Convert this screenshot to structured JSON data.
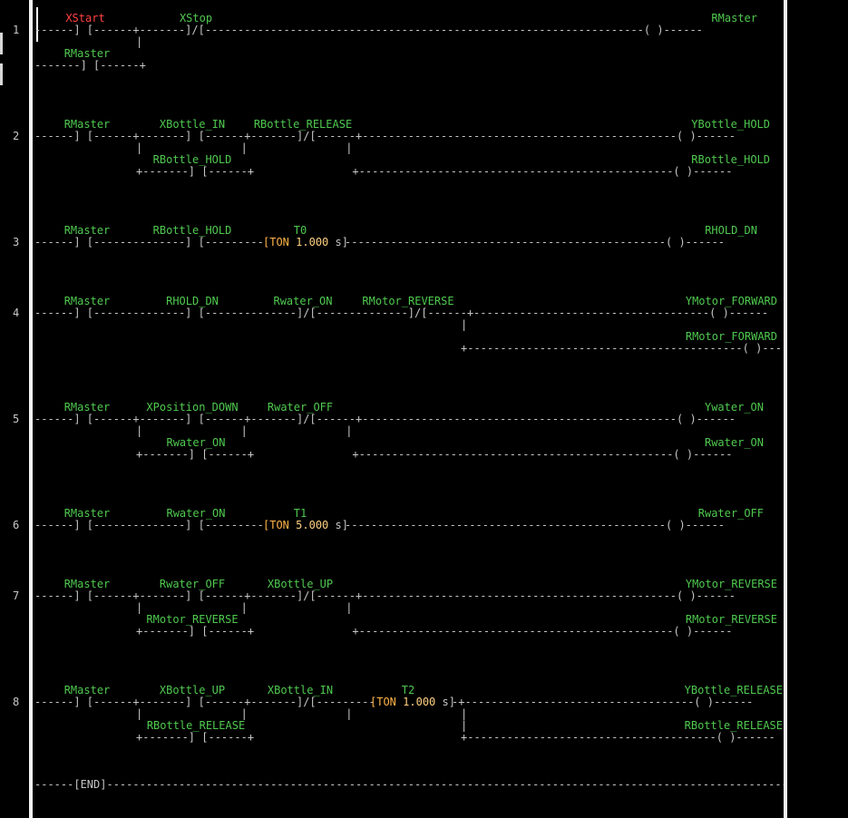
{
  "rungs": [
    "1",
    "2",
    "3",
    "4",
    "5",
    "6",
    "7",
    "8"
  ],
  "labels": {
    "r1_xstart": "XStart",
    "r1_xstop": "XStop",
    "r1_rmaster_coil": "RMaster",
    "r1_rmaster_latch": "RMaster",
    "r2_rmaster": "RMaster",
    "r2_xbottle_in": "XBottle_IN",
    "r2_rbottle_release": "RBottle_RELEASE",
    "r2_ybottle_hold": "YBottle_HOLD",
    "r2_rbottle_hold_latch": "RBottle_HOLD",
    "r2_rbottle_hold_coil": "RBottle_HOLD",
    "r3_rmaster": "RMaster",
    "r3_rbottle_hold": "RBottle_HOLD",
    "r3_t0": "T0",
    "r3_rhold_dn": "RHOLD_DN",
    "r4_rmaster": "RMaster",
    "r4_rhold_dn": "RHOLD_DN",
    "r4_rwater_on": "Rwater_ON",
    "r4_rmotor_reverse": "RMotor_REVERSE",
    "r4_ymotor_forward": "YMotor_FORWARD",
    "r4_rmotor_forward": "RMotor_FORWARD",
    "r5_rmaster": "RMaster",
    "r5_xposition_down": "XPosition_DOWN",
    "r5_rwater_off": "Rwater_OFF",
    "r5_ywater_on": "Ywater_ON",
    "r5_rwater_on_latch": "Rwater_ON",
    "r5_rwater_on_coil": "Rwater_ON",
    "r6_rmaster": "RMaster",
    "r6_rwater_on": "Rwater_ON",
    "r6_t1": "T1",
    "r6_rwater_off": "Rwater_OFF",
    "r7_rmaster": "RMaster",
    "r7_rwater_off": "Rwater_OFF",
    "r7_xbottle_up": "XBottle_UP",
    "r7_ymotor_reverse": "YMotor_REVERSE",
    "r7_rmotor_reverse_latch": "RMotor_REVERSE",
    "r7_rmotor_reverse_coil": "RMotor_REVERSE",
    "r8_rmaster": "RMaster",
    "r8_xbottle_up": "XBottle_UP",
    "r8_xbottle_in": "XBottle_IN",
    "r8_t2": "T2",
    "r8_ybottle_release": "YBottle_RELEASE",
    "r8_rbottle_release_latch": "RBottle_RELEASE",
    "r8_rbottle_release_coil": "RBottle_RELEASE"
  },
  "timers": {
    "t0": {
      "kw": "TON",
      "val": "1.000",
      "unit": "s"
    },
    "t1": {
      "kw": "TON",
      "val": "5.000",
      "unit": "s"
    },
    "t2": {
      "kw": "TON",
      "val": "1.000",
      "unit": "s"
    }
  },
  "lines": {
    "r1_a": "------] [------+-------]/[-------------------------------------------------------------------( )------",
    "r1_b": "|",
    "r1_c": "-------] [------+",
    "r2_a": "------] [------+-------] [------+-------]/[------+------------------------------------------------( )------",
    "r2_b": "|               |               |",
    "r2_c": "+-------] [------+               +------------------------------------------------( )------",
    "r3_a": "------] [--------------] [---------",
    "r3_b": "-------------------------------------------------( )------",
    "r4_a": "------] [--------------] [--------------]/[--------------]/[------+------------------------------------( )------",
    "r4_b": "|",
    "r4_c": "+------------------------------------------( )------",
    "r5_a": "------] [------+-------] [------+-------]/[------+------------------------------------------------( )------",
    "r5_b": "|               |               |",
    "r5_c": "+-------] [------+               +------------------------------------------------( )------",
    "r6_a": "------] [--------------] [---------",
    "r6_b": "-------------------------------------------------( )------",
    "r7_a": "------] [------+-------] [------+-------]/[------+------------------------------------------------( )------",
    "r7_b": "|               |               |",
    "r7_c": "+-------] [------+               +------------------------------------------------( )------",
    "r8_a": "------] [------+-------] [------+-------]/[---------",
    "r8_b": "-+-----------------------------------( )------",
    "r8_c": "|               |               |",
    "r8_d": "+-------] [------+               +------------------------------------( )------",
    "end": "------[END]-----------------------------------------------------------------------------------------------------------------"
  }
}
